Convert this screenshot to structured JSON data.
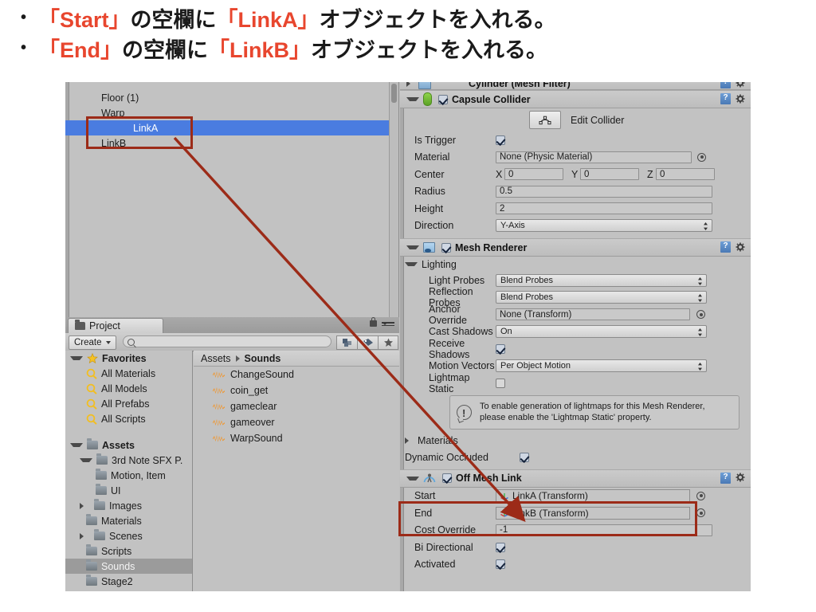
{
  "slide": {
    "bullets": [
      {
        "marker": "•",
        "parts": [
          {
            "t": "「Start」",
            "hl": true
          },
          {
            "t": "の空欄に",
            "hl": false
          },
          {
            "t": "「LinkA」",
            "hl": true
          },
          {
            "t": "オブジェクトを入れる。",
            "hl": false
          }
        ]
      },
      {
        "marker": "•",
        "parts": [
          {
            "t": "「End」",
            "hl": true
          },
          {
            "t": "の空欄に",
            "hl": false
          },
          {
            "t": "「LinkB」",
            "hl": true
          },
          {
            "t": "オブジェクトを入れる。",
            "hl": false
          }
        ]
      }
    ],
    "accent_color": "#e8462e",
    "annotation_color": "#9c2b18"
  },
  "hierarchy": {
    "items": [
      {
        "label": "Floor (1)",
        "selected": false
      },
      {
        "label": "Warp",
        "selected": false
      },
      {
        "label": "LinkA",
        "selected": true
      },
      {
        "label": "LinkB",
        "selected": false
      }
    ]
  },
  "project": {
    "tab_label": "Project",
    "tab_icon": "folder-icon",
    "create_label": "Create",
    "search_placeholder": "",
    "toolbar_icons": [
      "object-filter-icon",
      "label-filter-icon",
      "favorite-star-icon"
    ],
    "tree": [
      {
        "label": "Favorites",
        "depth": 0,
        "arrow": "down",
        "icon": "star-icon",
        "bold": true,
        "selected": false
      },
      {
        "label": "All Materials",
        "depth": 1,
        "arrow": "none",
        "icon": "search-icon",
        "bold": false,
        "selected": false
      },
      {
        "label": "All Models",
        "depth": 1,
        "arrow": "none",
        "icon": "search-icon",
        "bold": false,
        "selected": false
      },
      {
        "label": "All Prefabs",
        "depth": 1,
        "arrow": "none",
        "icon": "search-icon",
        "bold": false,
        "selected": false
      },
      {
        "label": "All Scripts",
        "depth": 1,
        "arrow": "none",
        "icon": "search-icon",
        "bold": false,
        "selected": false
      },
      {
        "label": "",
        "depth": 0,
        "arrow": "none",
        "icon": "none",
        "bold": false,
        "selected": false
      },
      {
        "label": "Assets",
        "depth": 0,
        "arrow": "down",
        "icon": "folder-icon",
        "bold": true,
        "selected": false
      },
      {
        "label": "3rd Note SFX P.",
        "depth": 1,
        "arrow": "down",
        "icon": "folder-icon",
        "bold": false,
        "selected": false
      },
      {
        "label": "Motion, Item",
        "depth": 2,
        "arrow": "none",
        "icon": "folder-icon",
        "bold": false,
        "selected": false
      },
      {
        "label": "UI",
        "depth": 2,
        "arrow": "none",
        "icon": "folder-icon",
        "bold": false,
        "selected": false
      },
      {
        "label": "Images",
        "depth": 1,
        "arrow": "right",
        "icon": "folder-icon",
        "bold": false,
        "selected": false
      },
      {
        "label": "Materials",
        "depth": 1,
        "arrow": "none",
        "icon": "folder-icon",
        "bold": false,
        "selected": false
      },
      {
        "label": "Scenes",
        "depth": 1,
        "arrow": "right",
        "icon": "folder-icon",
        "bold": false,
        "selected": false
      },
      {
        "label": "Scripts",
        "depth": 1,
        "arrow": "none",
        "icon": "folder-icon",
        "bold": false,
        "selected": false
      },
      {
        "label": "Sounds",
        "depth": 1,
        "arrow": "none",
        "icon": "folder-icon",
        "bold": false,
        "selected": true
      },
      {
        "label": "Stage2",
        "depth": 1,
        "arrow": "none",
        "icon": "folder-icon",
        "bold": false,
        "selected": false
      }
    ],
    "breadcrumb": [
      "Assets",
      "Sounds"
    ],
    "assets": [
      {
        "name": "ChangeSound",
        "icon": "audio-clip-icon"
      },
      {
        "name": "coin_get",
        "icon": "audio-clip-icon"
      },
      {
        "name": "gameclear",
        "icon": "audio-clip-icon"
      },
      {
        "name": "gameover",
        "icon": "audio-clip-icon"
      },
      {
        "name": "WarpSound",
        "icon": "audio-clip-icon"
      }
    ]
  },
  "inspector": {
    "components": [
      {
        "id": "mesh-filter",
        "title": "Cylinder (Mesh Filter)",
        "collapsed": true,
        "checkbox": null,
        "icon": "mesh-filter-icon"
      },
      {
        "id": "capsule-collider",
        "title": "Capsule Collider",
        "collapsed": false,
        "checkbox": true,
        "icon": "capsule-collider-icon",
        "edit_collider_label": "Edit Collider",
        "rows": [
          {
            "label": "Is Trigger",
            "type": "checkbox",
            "value": true
          },
          {
            "label": "Material",
            "type": "object",
            "value": "None (Physic Material)"
          },
          {
            "label": "Center",
            "type": "vector3",
            "axes": [
              "X",
              "Y",
              "Z"
            ],
            "values": [
              "0",
              "0",
              "0"
            ]
          },
          {
            "label": "Radius",
            "type": "text",
            "value": "0.5"
          },
          {
            "label": "Height",
            "type": "text",
            "value": "2"
          },
          {
            "label": "Direction",
            "type": "popup",
            "value": "Y-Axis"
          }
        ]
      },
      {
        "id": "mesh-renderer",
        "title": "Mesh Renderer",
        "collapsed": false,
        "checkbox": true,
        "icon": "mesh-renderer-icon",
        "group_label": "Lighting",
        "rows": [
          {
            "label": "Light Probes",
            "type": "popup",
            "value": "Blend Probes"
          },
          {
            "label": "Reflection Probes",
            "type": "popup",
            "value": "Blend Probes"
          },
          {
            "label": "Anchor Override",
            "type": "object",
            "value": "None (Transform)"
          },
          {
            "label": "Cast Shadows",
            "type": "popup",
            "value": "On"
          },
          {
            "label": "Receive Shadows",
            "type": "checkbox",
            "value": true
          },
          {
            "label": "Motion Vectors",
            "type": "popup",
            "value": "Per Object Motion"
          },
          {
            "label": "Lightmap Static",
            "type": "checkbox",
            "value": false
          }
        ],
        "help_text": "To enable generation of lightmaps for this Mesh Renderer, please enable the 'Lightmap Static' property.",
        "help_icon": "info-icon",
        "foldouts": [
          {
            "label": "Materials",
            "collapsed": true
          }
        ],
        "extra_rows": [
          {
            "label": "Dynamic Occluded",
            "type": "checkbox",
            "value": true
          }
        ]
      },
      {
        "id": "off-mesh-link",
        "title": "Off Mesh Link",
        "collapsed": false,
        "checkbox": true,
        "icon": "off-mesh-link-icon",
        "rows": [
          {
            "label": "Start",
            "type": "objectref",
            "value": "LinkA (Transform)",
            "icon": "transform-icon",
            "highlighted": true
          },
          {
            "label": "End",
            "type": "objectref",
            "value": "LinkB (Transform)",
            "icon": "transform-icon",
            "highlighted": true
          },
          {
            "label": "Cost Override",
            "type": "text",
            "value": "-1"
          },
          {
            "label": "Bi Directional",
            "type": "checkbox",
            "value": true
          },
          {
            "label": "Activated",
            "type": "checkbox",
            "value": true
          }
        ]
      }
    ]
  }
}
